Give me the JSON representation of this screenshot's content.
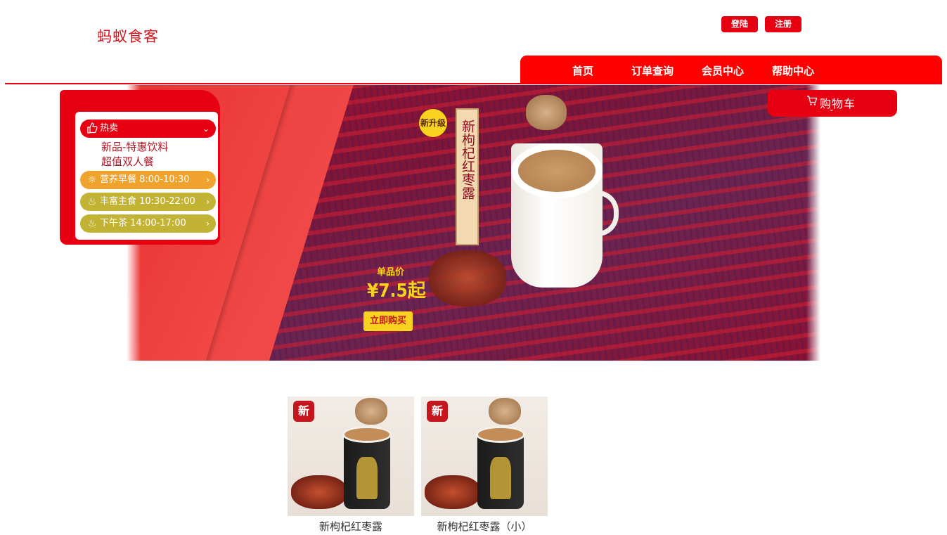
{
  "site": {
    "logo": "蚂蚁食客"
  },
  "auth": {
    "login": "登陆",
    "register": "注册"
  },
  "nav": {
    "items": [
      "首页",
      "订单查询",
      "会员中心",
      "帮助中心"
    ]
  },
  "cart": {
    "label": "购物车"
  },
  "menu": {
    "hot": {
      "label": "热卖",
      "sub_items": [
        "新品-特惠饮料",
        "超值双人餐"
      ]
    },
    "breakfast": "营养早餐 8:00-10:30",
    "lunch": "丰富主食 10:30-22:00",
    "tea": "下午茶 14:00-17:00"
  },
  "banner": {
    "badge": "新升级",
    "product_title": "新枸杞红枣露",
    "price_label": "单品价",
    "price": "¥7.5起",
    "buy_button": "立即购买"
  },
  "products": [
    {
      "badge": "新",
      "name": "新枸杞红枣露"
    },
    {
      "badge": "新",
      "name": "新枸杞红枣露（小）"
    }
  ],
  "colors": {
    "brand_red": "#e60012",
    "nav_red": "#ff0000",
    "breakfast_orange": "#f0a32c",
    "olive": "#c3b334"
  }
}
